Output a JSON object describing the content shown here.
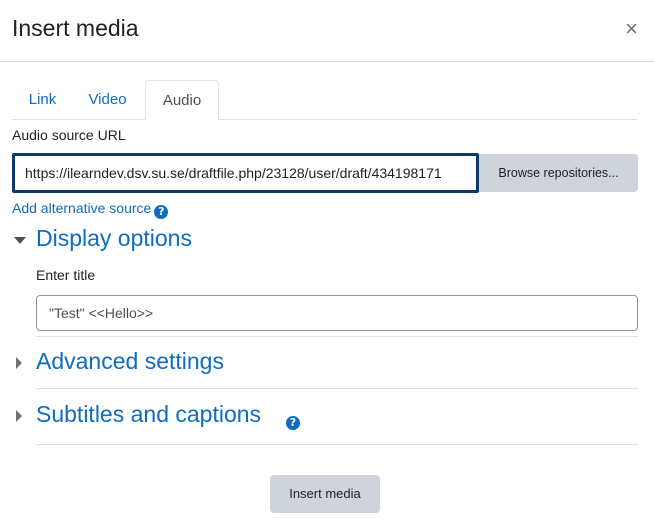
{
  "dialog": {
    "title": "Insert media",
    "close_glyph": "×"
  },
  "tabs": [
    {
      "label": "Link",
      "active": false
    },
    {
      "label": "Video",
      "active": false
    },
    {
      "label": "Audio",
      "active": true
    }
  ],
  "audio": {
    "source_label": "Audio source URL",
    "source_value": "https://ilearndev.dsv.su.se/draftfile.php/23128/user/draft/434198171",
    "browse_label": "Browse repositories...",
    "add_alternative_label": "Add alternative source"
  },
  "display_options": {
    "heading": "Display options",
    "expanded": true,
    "title_label": "Enter title",
    "title_value": "\"Test\" <<Hello>>"
  },
  "advanced_settings": {
    "heading": "Advanced settings",
    "expanded": false
  },
  "subtitles": {
    "heading": "Subtitles and captions",
    "expanded": false
  },
  "help_glyph": "?",
  "footer": {
    "insert_label": "Insert media"
  },
  "colors": {
    "link": "#0f6cbf",
    "focus_border": "#0b3a66",
    "button_bg": "#ced4da",
    "divider": "#dee2e6"
  },
  "icons": {
    "close": "close-icon",
    "help": "help-icon",
    "expanded": "caret-down-icon",
    "collapsed": "caret-right-icon"
  }
}
